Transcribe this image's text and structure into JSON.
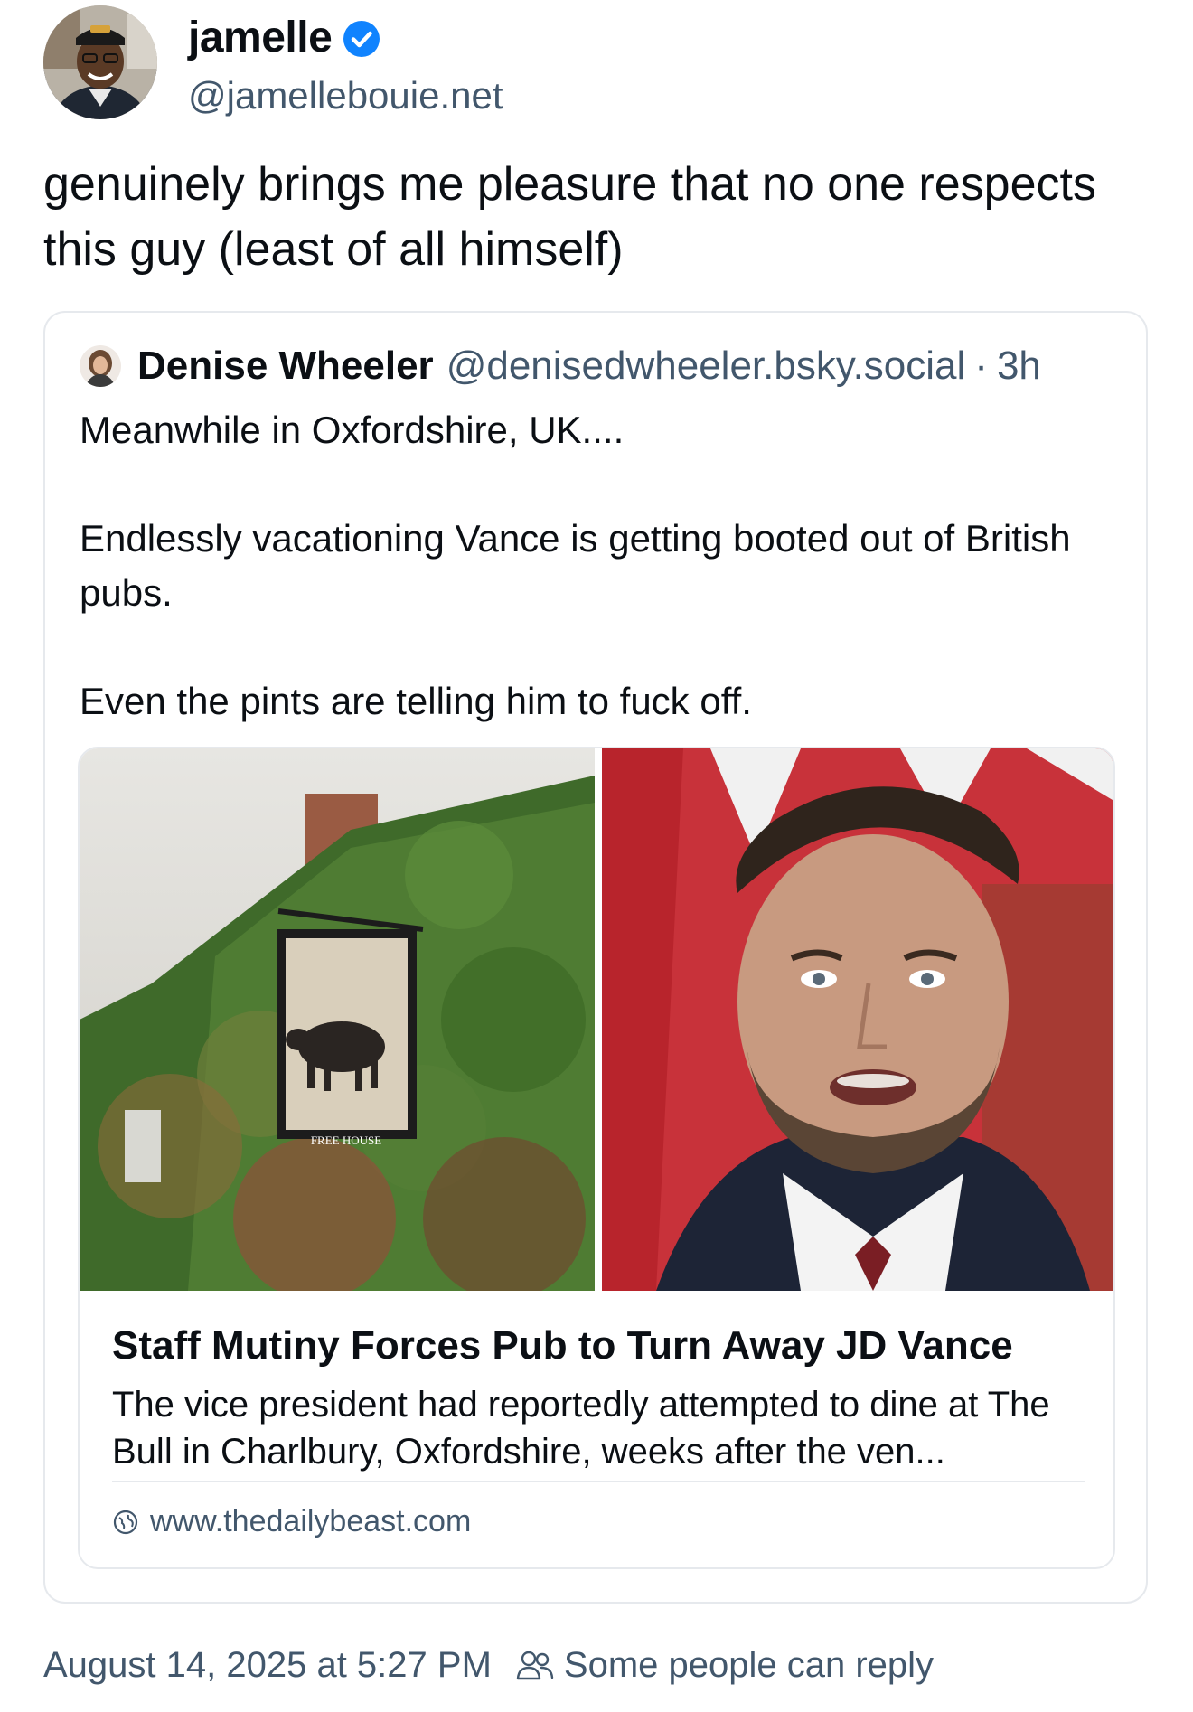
{
  "author": {
    "display_name": "jamelle",
    "handle": "@jamellebouie.net",
    "verified_icon": "verified-check-icon"
  },
  "post": {
    "text": "genuinely brings me pleasure that no one respects this guy (least of all himself)"
  },
  "quote": {
    "author_name": "Denise Wheeler",
    "author_handle": "@denisedwheeler.bsky.social",
    "separator": "·",
    "time": "3h",
    "text": "Meanwhile in Oxfordshire, UK....\n\nEndlessly vacationing Vance is getting booted out of British pubs.\n\nEven the pints are telling him to fuck off."
  },
  "link_card": {
    "title": "Staff Mutiny Forces Pub to Turn Away JD Vance",
    "description": "The vice president had reportedly attempted to dine at The Bull in Charlbury, Oxfordshire, weeks after the ven...",
    "domain": "www.thedailybeast.com",
    "image_sign_text": "FREE HOUSE"
  },
  "footer": {
    "timestamp": "August 14, 2025 at 5:27 PM",
    "reply_setting": "Some people can reply"
  },
  "colors": {
    "text_primary": "#0b0f14",
    "text_secondary": "#42576c",
    "verified_blue": "#1083fe",
    "border": "#e6e9ed"
  }
}
